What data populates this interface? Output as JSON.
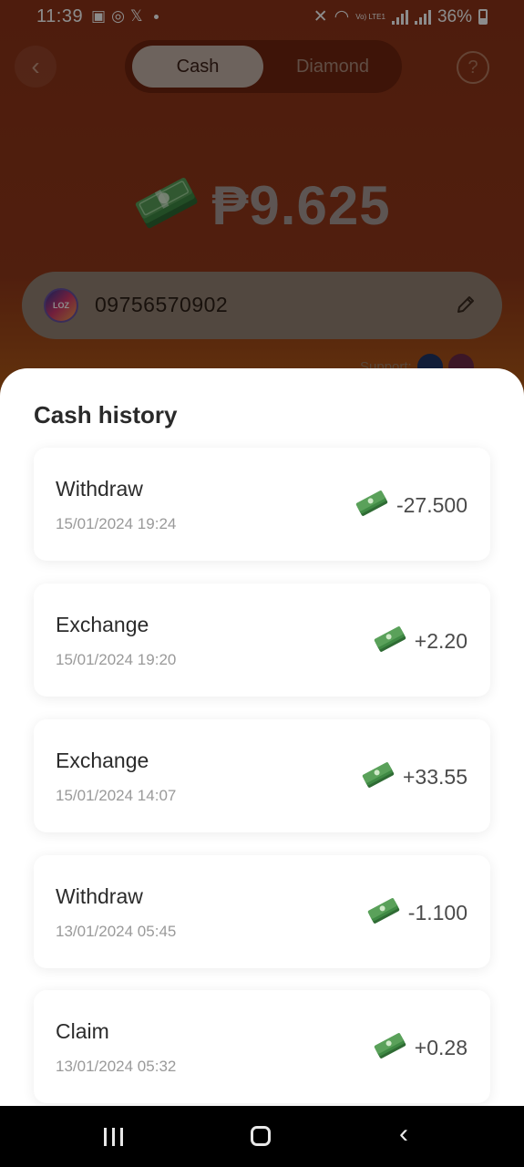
{
  "status_bar": {
    "time": "11:39",
    "battery": "36%",
    "network": "Vo) LTE1"
  },
  "header": {
    "tabs": [
      {
        "label": "Cash",
        "active": true
      },
      {
        "label": "Diamond",
        "active": false
      }
    ],
    "help_label": "?"
  },
  "balance": {
    "amount": "₱9.625",
    "icon": "cash-stack-icon"
  },
  "account": {
    "logo_text": "LOZ",
    "number": "09756570902"
  },
  "support": {
    "label": "Support:"
  },
  "history": {
    "title": "Cash history",
    "items": [
      {
        "type": "Withdraw",
        "date": "15/01/2024 19:24",
        "amount": "-27.500"
      },
      {
        "type": "Exchange",
        "date": "15/01/2024 19:20",
        "amount": "+2.20"
      },
      {
        "type": "Exchange",
        "date": "15/01/2024 14:07",
        "amount": "+33.55"
      },
      {
        "type": "Withdraw",
        "date": "13/01/2024 05:45",
        "amount": "-1.100"
      },
      {
        "type": "Claim",
        "date": "13/01/2024 05:32",
        "amount": "+0.28"
      }
    ]
  },
  "colors": {
    "header_gradient_top": "#8e3418",
    "header_gradient_bottom": "#d7850f",
    "money_green": "#5aa15a"
  }
}
